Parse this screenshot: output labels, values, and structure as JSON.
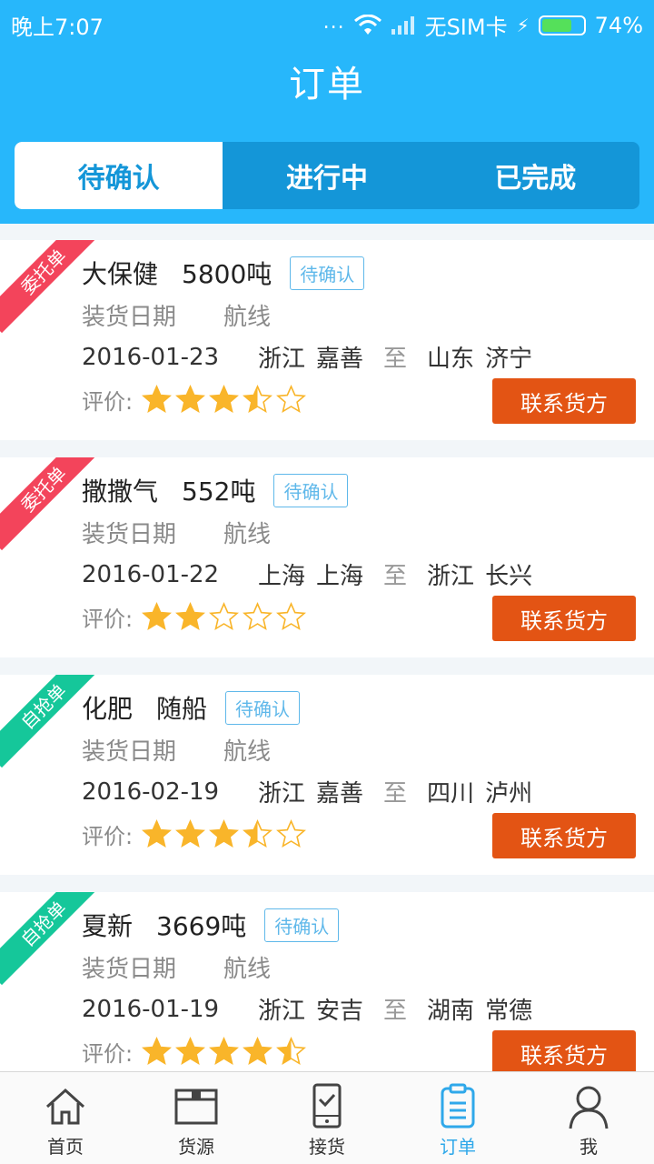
{
  "status_bar": {
    "time": "晚上7:07",
    "dots": "...",
    "sim": "无SIM卡",
    "battery": "74%",
    "battery_level": 0.74
  },
  "title": "订单",
  "tabs": [
    {
      "label": "待确认",
      "active": true
    },
    {
      "label": "进行中",
      "active": false
    },
    {
      "label": "已完成",
      "active": false
    }
  ],
  "field_labels": {
    "load_date": "装货日期",
    "route": "航线",
    "to": "至",
    "rating": "评价:",
    "contact": "联系货方"
  },
  "orders": [
    {
      "ribbon": "委托单",
      "ribbon_color": "#f3445b",
      "cargo": "大保健",
      "qty": "5800吨",
      "status": "待确认",
      "date": "2016-01-23",
      "from_prov": "浙江",
      "from_city": "嘉善",
      "to_prov": "山东",
      "to_city": "济宁",
      "rating": 3.5
    },
    {
      "ribbon": "委托单",
      "ribbon_color": "#f3445b",
      "cargo": "撒撒气",
      "qty": "552吨",
      "status": "待确认",
      "date": "2016-01-22",
      "from_prov": "上海",
      "from_city": "上海",
      "to_prov": "浙江",
      "to_city": "长兴",
      "rating": 2
    },
    {
      "ribbon": "自抢单",
      "ribbon_color": "#15c79a",
      "cargo": "化肥",
      "qty": "随船",
      "status": "待确认",
      "date": "2016-02-19",
      "from_prov": "浙江",
      "from_city": "嘉善",
      "to_prov": "四川",
      "to_city": "泸州",
      "rating": 3.5
    },
    {
      "ribbon": "自抢单",
      "ribbon_color": "#15c79a",
      "cargo": "夏新",
      "qty": "3669吨",
      "status": "待确认",
      "date": "2016-01-19",
      "from_prov": "浙江",
      "from_city": "安吉",
      "to_prov": "湖南",
      "to_city": "常德",
      "rating": 4.5
    }
  ],
  "bottom_nav": [
    {
      "label": "首页",
      "icon": "home-icon",
      "active": false
    },
    {
      "label": "货源",
      "icon": "box-icon",
      "active": false
    },
    {
      "label": "接货",
      "icon": "phone-check-icon",
      "active": false
    },
    {
      "label": "订单",
      "icon": "clipboard-icon",
      "active": true
    },
    {
      "label": "我",
      "icon": "user-icon",
      "active": false
    }
  ],
  "colors": {
    "header": "#27b7fb",
    "accent": "#1496d8",
    "contact": "#e35414",
    "star": "#f9b52a"
  }
}
